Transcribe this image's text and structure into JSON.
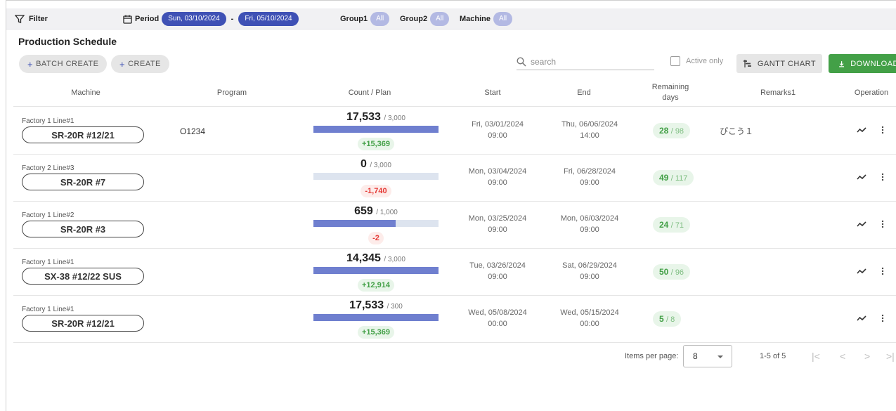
{
  "filter": {
    "label": "Filter",
    "period_label": "Period",
    "period_start": "Sun, 03/10/2024",
    "period_sep": "-",
    "period_end": "Fri, 05/10/2024",
    "group1_label": "Group1",
    "group1_value": "All",
    "group2_label": "Group2",
    "group2_value": "All",
    "machine_label": "Machine",
    "machine_value": "All"
  },
  "page_title": "Production Schedule",
  "toolbar": {
    "batch_create": "BATCH CREATE",
    "create": "CREATE",
    "search_placeholder": "search",
    "active_only": "Active only",
    "gantt_chart": "GANTT CHART",
    "download": "DOWNLOAD"
  },
  "columns": {
    "machine": "Machine",
    "program": "Program",
    "count_plan": "Count / Plan",
    "start": "Start",
    "end": "End",
    "remaining_days": "Remaining days",
    "remarks1": "Remarks1",
    "operation": "Operation"
  },
  "rows": [
    {
      "factory": "Factory 1 Line#1",
      "machine": "SR-20R #12/21",
      "program": "O1234",
      "count": "17,533",
      "plan": "/ 3,000",
      "progress": 1.0,
      "diff": "+15,369",
      "start_date": "Fri, 03/01/2024",
      "start_time": "09:00",
      "end_date": "Thu, 06/06/2024",
      "end_time": "14:00",
      "remain_value": "28",
      "remain_total": "/ 98",
      "remarks": "ぴこう１"
    },
    {
      "factory": "Factory 2 Line#3",
      "machine": "SR-20R #7",
      "program": "",
      "count": "0",
      "plan": "/ 3,000",
      "progress": 0.0,
      "diff": "-1,740",
      "start_date": "Mon, 03/04/2024",
      "start_time": "09:00",
      "end_date": "Fri, 06/28/2024",
      "end_time": "09:00",
      "remain_value": "49",
      "remain_total": "/ 117",
      "remarks": ""
    },
    {
      "factory": "Factory 1 Line#2",
      "machine": "SR-20R #3",
      "program": "",
      "count": "659",
      "plan": "/ 1,000",
      "progress": 0.659,
      "diff": "-2",
      "start_date": "Mon, 03/25/2024",
      "start_time": "09:00",
      "end_date": "Mon, 06/03/2024",
      "end_time": "09:00",
      "remain_value": "24",
      "remain_total": "/ 71",
      "remarks": ""
    },
    {
      "factory": "Factory 1 Line#1",
      "machine": "SX-38 #12/22 SUS",
      "program": "",
      "count": "14,345",
      "plan": "/ 3,000",
      "progress": 1.0,
      "diff": "+12,914",
      "start_date": "Tue, 03/26/2024",
      "start_time": "09:00",
      "end_date": "Sat, 06/29/2024",
      "end_time": "09:00",
      "remain_value": "50",
      "remain_total": "/ 96",
      "remarks": ""
    },
    {
      "factory": "Factory 1 Line#1",
      "machine": "SR-20R #12/21",
      "program": "",
      "count": "17,533",
      "plan": "/ 300",
      "progress": 1.0,
      "diff": "+15,369",
      "start_date": "Wed, 05/08/2024",
      "start_time": "00:00",
      "end_date": "Wed, 05/15/2024",
      "end_time": "00:00",
      "remain_value": "5",
      "remain_total": "/ 8",
      "remarks": ""
    }
  ],
  "pagination": {
    "items_per_page_label": "Items per page:",
    "items_per_page": "8",
    "range": "1-5 of 5"
  },
  "colors": {
    "primary": "#3f51b5",
    "success": "#43a047",
    "danger": "#e53935",
    "progress_fill": "#6f7fcf",
    "progress_bg": "#dde4ef"
  },
  "icons": [
    "filter-icon",
    "calendar-icon",
    "search-icon",
    "gantt-icon",
    "download-icon",
    "trend-icon",
    "more-vert-icon",
    "first-page-icon",
    "prev-page-icon",
    "next-page-icon",
    "last-page-icon"
  ]
}
